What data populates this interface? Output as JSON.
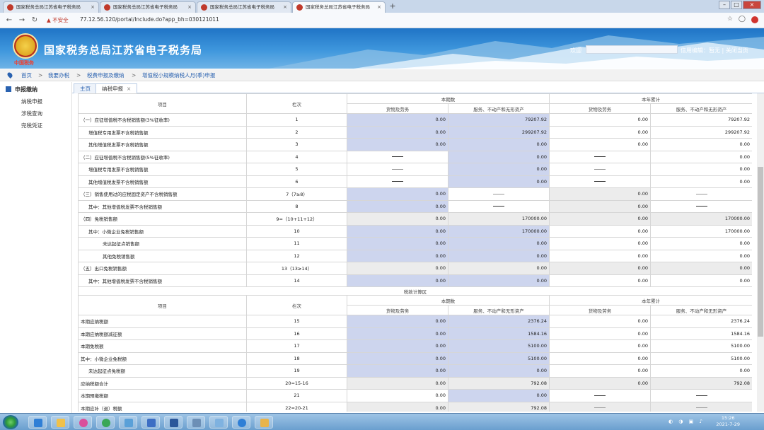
{
  "browser": {
    "tabs": [
      {
        "title": "国家税务总局江苏省电子税务局"
      },
      {
        "title": "国家税务总局江苏省电子税务局"
      },
      {
        "title": "国家税务总局江苏省电子税务局"
      },
      {
        "title": "国家税务总局江苏省电子税务局"
      }
    ],
    "new_tab_label": "+",
    "insecure_label": "不安全",
    "url": "77.12.56.120/portal/Include.do?app_bh=030121011"
  },
  "header": {
    "site_title": "国家税务总局江苏省电子税务局",
    "emblem_sub": "中国税务",
    "welcome": "欢迎",
    "links": "信用编辑：暂无 | 关闭当页"
  },
  "breadcrumb": [
    "首页",
    "我要办税",
    "税费申报及缴纳",
    "增值税小规模纳税人月(季)申报"
  ],
  "breadcrumb_sep": ">",
  "sidebar": {
    "heading": "申报缴纳",
    "items": [
      "纳税申报",
      "涉税查询",
      "完税凭证"
    ]
  },
  "content_tabs": [
    {
      "label": "主页"
    },
    {
      "label": "纳税申报"
    }
  ],
  "table": {
    "header": {
      "item": "项目",
      "line": "栏次",
      "current": "本期数",
      "ytd": "本年累计",
      "goods": "货物及劳务",
      "services": "服务、不动产和无形资产"
    },
    "rows_a": [
      {
        "name": "（一）应征增值税不含税销售额(3%征收率)",
        "line": "1",
        "v": [
          "0.00",
          "79207.92",
          "0.00",
          "79207.92"
        ]
      },
      {
        "name": "增值税专用发票不含税销售额",
        "line": "2",
        "v": [
          "0.00",
          "299207.92",
          "0.00",
          "299207.92"
        ]
      },
      {
        "name": "其他增值税发票不含税销售额",
        "line": "3",
        "v": [
          "0.00",
          "0.00",
          "0.00",
          "0.00"
        ]
      },
      {
        "name": "（二）应征增值税不含税销售额(5%征收率)",
        "line": "4",
        "v": [
          "",
          "0.00",
          "",
          "0.00"
        ]
      },
      {
        "name": "增值税专用发票不含税销售额",
        "line": "5",
        "v": [
          "",
          "0.00",
          "",
          "0.00"
        ]
      },
      {
        "name": "其他增值税发票不含税销售额",
        "line": "6",
        "v": [
          "",
          "0.00",
          "",
          "0.00"
        ]
      },
      {
        "name": "（三）销售使用过的应税固定资产不含税销售额",
        "line": "7（7≥8）",
        "v": [
          "0.00",
          "",
          "0.00",
          ""
        ]
      },
      {
        "name": "其中：其他增值税发票不含税销售额",
        "line": "8",
        "v": [
          "0.00",
          "",
          "0.00",
          ""
        ]
      },
      {
        "name": "（四）免税销售额",
        "line": "9=（10+11+12）",
        "v": [
          "0.00",
          "170000.00",
          "0.00",
          "170000.00"
        ]
      },
      {
        "name": "其中：小微企业免税销售额",
        "line": "10",
        "v": [
          "0.00",
          "170000.00",
          "0.00",
          "170000.00"
        ]
      },
      {
        "name": "未达起征点销售额",
        "line": "11",
        "v": [
          "0.00",
          "0.00",
          "0.00",
          "0.00"
        ]
      },
      {
        "name": "其他免税销售额",
        "line": "12",
        "v": [
          "0.00",
          "0.00",
          "0.00",
          "0.00"
        ]
      },
      {
        "name": "（五）出口免税销售额",
        "line": "13（13≥14）",
        "v": [
          "0.00",
          "0.00",
          "0.00",
          "0.00"
        ]
      },
      {
        "name": "其中：其他增值税发票不含税销售额",
        "line": "14",
        "v": [
          "0.00",
          "0.00",
          "0.00",
          "0.00"
        ]
      }
    ],
    "section_b_title": "税款计算区",
    "rows_b": [
      {
        "name": "本期应纳税额",
        "line": "15",
        "v": [
          "0.00",
          "2376.24",
          "0.00",
          "2376.24"
        ]
      },
      {
        "name": "本期应纳税额减征额",
        "line": "16",
        "v": [
          "0.00",
          "1584.16",
          "0.00",
          "1584.16"
        ]
      },
      {
        "name": "本期免税额",
        "line": "17",
        "v": [
          "0.00",
          "5100.00",
          "0.00",
          "5100.00"
        ]
      },
      {
        "name": "其中：小微企业免税额",
        "line": "18",
        "v": [
          "0.00",
          "5100.00",
          "0.00",
          "5100.00"
        ]
      },
      {
        "name": "未达起征点免税额",
        "line": "19",
        "v": [
          "0.00",
          "0.00",
          "0.00",
          "0.00"
        ]
      },
      {
        "name": "应纳税额合计",
        "line": "20=15-16",
        "v": [
          "0.00",
          "792.08",
          "0.00",
          "792.08"
        ]
      },
      {
        "name": "本期预缴税额",
        "line": "21",
        "v": [
          "0.00",
          "0.00",
          "",
          ""
        ]
      },
      {
        "name": "本期应补（退）税额",
        "line": "22=20-21",
        "v": [
          "0.00",
          "792.08",
          "",
          ""
        ]
      }
    ]
  },
  "taskbar": {
    "time": "15:26",
    "date": "2021-7-29"
  }
}
